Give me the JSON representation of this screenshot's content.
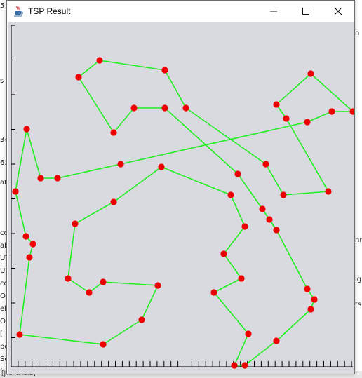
{
  "window": {
    "title": "TSP Result",
    "app_icon": "java-coffee-icon",
    "minimize_icon": "minimize-icon",
    "maximize_icon": "maximize-icon",
    "close_icon": "close-icon"
  },
  "background": {
    "left_fragments": [
      "5",
      "s",
      "34",
      "6.",
      "at",
      "co",
      "ab",
      "UT",
      "UB",
      "co",
      "OL",
      "el",
      "OL",
      "[",
      "be",
      "Se",
      "[J"
    ],
    "right_fragments": [
      "n",
      "nn",
      "ig",
      "ts"
    ],
    "bottom_fragment": "[JTextField]"
  },
  "colors": {
    "plot_background": "#d9d9e0",
    "route_line": "#22ee22",
    "city_point": "#ee0000",
    "axis": "#000000"
  },
  "tour": [
    [
      141,
      85
    ],
    [
      234,
      99
    ],
    [
      264,
      153
    ],
    [
      378,
      233
    ],
    [
      403,
      277
    ],
    [
      467,
      272
    ],
    [
      407,
      168
    ],
    [
      393,
      148
    ],
    [
      442,
      104
    ],
    [
      502,
      158
    ],
    [
      472,
      158
    ],
    [
      437,
      173
    ],
    [
      171,
      233
    ],
    [
      81,
      253
    ],
    [
      57,
      253
    ],
    [
      37,
      183
    ],
    [
      21,
      272
    ],
    [
      36,
      336
    ],
    [
      46,
      347
    ],
    [
      41,
      366
    ],
    [
      27,
      476
    ],
    [
      146,
      490
    ],
    [
      201,
      455
    ],
    [
      224,
      406
    ],
    [
      146,
      401
    ],
    [
      126,
      416
    ],
    [
      96,
      396
    ],
    [
      106,
      318
    ],
    [
      161,
      287
    ],
    [
      229,
      237
    ],
    [
      328,
      277
    ],
    [
      348,
      322
    ],
    [
      318,
      361
    ],
    [
      343,
      396
    ],
    [
      304,
      416
    ],
    [
      353,
      475
    ],
    [
      333,
      520
    ],
    [
      348,
      520
    ],
    [
      393,
      485
    ],
    [
      442,
      440
    ],
    [
      447,
      426
    ],
    [
      437,
      411
    ],
    [
      393,
      327
    ],
    [
      383,
      312
    ],
    [
      373,
      297
    ],
    [
      338,
      247
    ],
    [
      234,
      153
    ],
    [
      190,
      153
    ],
    [
      161,
      188
    ],
    [
      111,
      109
    ]
  ]
}
